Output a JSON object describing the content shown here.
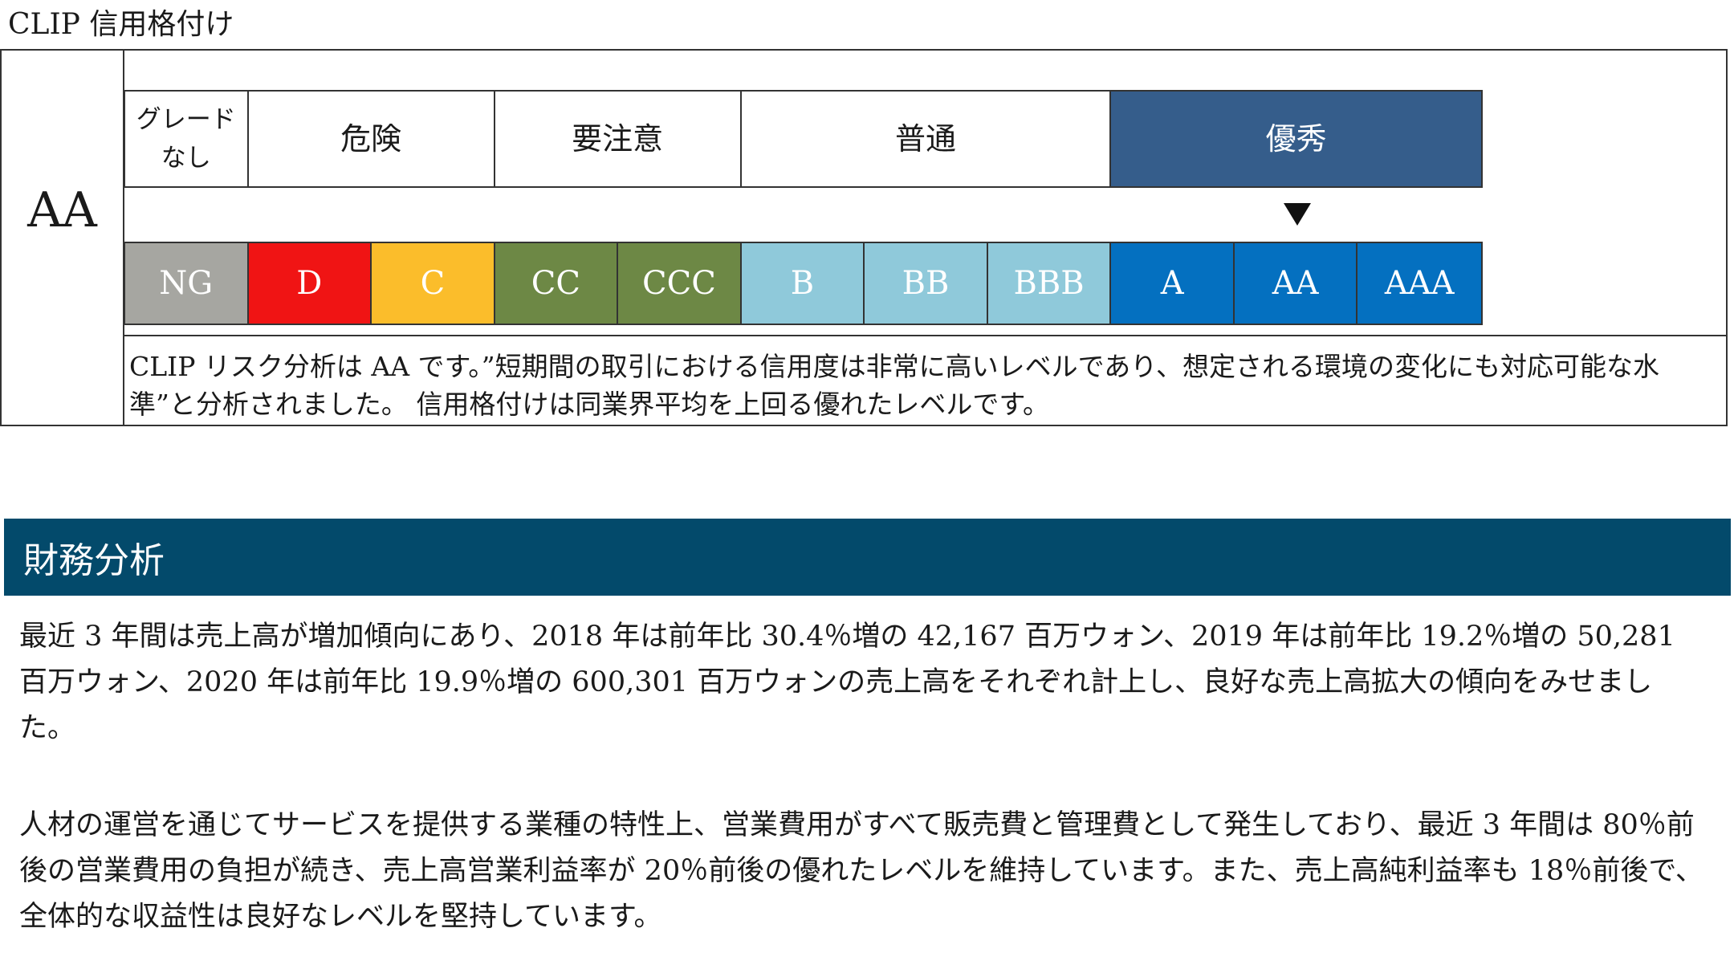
{
  "title": "CLIP 信用格付け",
  "rating": {
    "grade": "AA",
    "categories": [
      {
        "label": "グレード\nなし",
        "span": 1,
        "bg": "#ffffff",
        "fg": "#1a1a1a"
      },
      {
        "label": "危険",
        "span": 2,
        "bg": "#ffffff",
        "fg": "#1a1a1a"
      },
      {
        "label": "要注意",
        "span": 2,
        "bg": "#ffffff",
        "fg": "#1a1a1a"
      },
      {
        "label": "普通",
        "span": 3,
        "bg": "#ffffff",
        "fg": "#1a1a1a"
      },
      {
        "label": "優秀",
        "span": 3,
        "bg": "#355d8b",
        "fg": "#ffffff"
      }
    ],
    "grades": [
      {
        "label": "NG",
        "color": "#a6a6a1"
      },
      {
        "label": "D",
        "color": "#f01414"
      },
      {
        "label": "C",
        "color": "#fbbd2b"
      },
      {
        "label": "CC",
        "color": "#6d8845"
      },
      {
        "label": "CCC",
        "color": "#6d8845"
      },
      {
        "label": "B",
        "color": "#8fc9da"
      },
      {
        "label": "BB",
        "color": "#8fc9da"
      },
      {
        "label": "BBB",
        "color": "#8fc9da"
      },
      {
        "label": "A",
        "color": "#0470c0"
      },
      {
        "label": "AA",
        "color": "#0470c0"
      },
      {
        "label": "AAA",
        "color": "#0470c0"
      }
    ],
    "current_index": 9,
    "marker_icon": "down-triangle-icon",
    "description": "CLIP リスク分析は AA です。”短期間の取引における信用度は非常に高いレベルであり、想定される環境の変化にも対応可能な水準”と分析されました。 信用格付けは同業界平均を上回る優れたレベルです。"
  },
  "financial": {
    "header": "財務分析",
    "header_color": "#034a6b",
    "paragraphs": [
      "最近 3 年間は売上高が増加傾向にあり、2018 年は前年比 30.4％増の 42,167 百万ウォン、2019 年は前年比 19.2％増の 50,281 百万ウォン、2020 年は前年比 19.9％増の 600,301 百万ウォンの売上高をそれぞれ計上し、良好な売上高拡大の傾向をみせました。",
      "人材の運営を通じてサービスを提供する業種の特性上、営業費用がすべて販売費と管理費として発生しており、最近 3 年間は 80％前後の営業費用の負担が続き、売上高営業利益率が 20％前後の優れたレベルを維持しています。また、売上高純利益率も 18％前後で、全体的な収益性は良好なレベルを堅持しています。"
    ]
  }
}
